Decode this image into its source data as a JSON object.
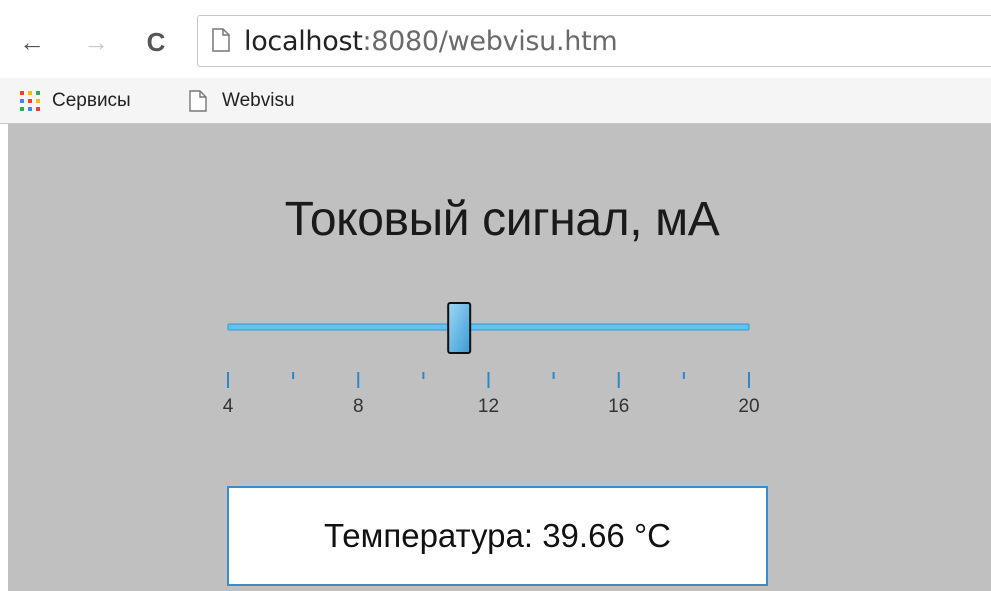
{
  "browser": {
    "url_host": "localhost",
    "url_rest": ":8080/webvisu.htm",
    "bookmarks": [
      {
        "label": "Сервисы",
        "icon": "apps-grid-icon"
      },
      {
        "label": "Webvisu",
        "icon": "page-icon"
      }
    ]
  },
  "main": {
    "title": "Токовый сигнал, мА",
    "slider": {
      "min": 4,
      "max": 20,
      "value": 11.1,
      "major_ticks": [
        4,
        8,
        12,
        16,
        20
      ],
      "minor_ticks": [
        6,
        10,
        14,
        18
      ],
      "track_color": "#5fc3ef",
      "handle_color": "#3a9bd5"
    },
    "temperature_label": "Температура: 39.66 °C",
    "box_border_color": "#3c8dc6"
  }
}
